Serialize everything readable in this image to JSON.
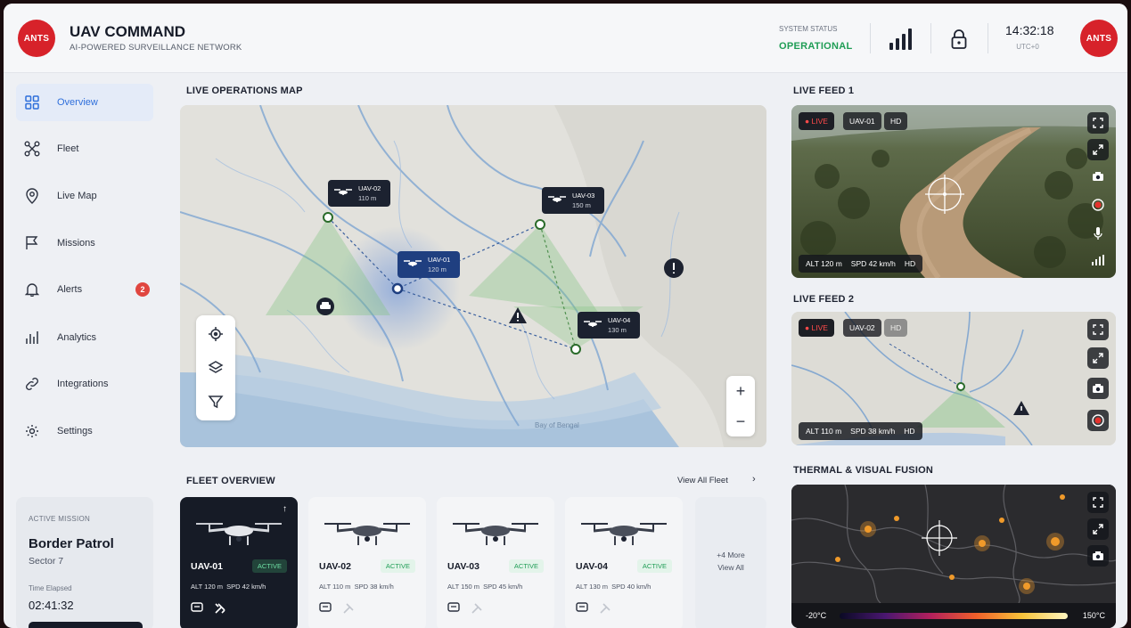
{
  "header": {
    "logo_text": "ANTS",
    "title": "UAV COMMAND",
    "subtitle": "AI-POWERED SURVEILLANCE NETWORK",
    "status_label": "SYSTEM STATUS",
    "status_value": "OPERATIONAL",
    "status_color": "#1f9d55",
    "time": "14:32:18",
    "timezone": "UTC+0",
    "icons": [
      "signal-icon",
      "lock-icon"
    ],
    "accent_color": "#d7222a"
  },
  "sidebar": {
    "items": [
      {
        "label": "Overview",
        "icon": "grid-icon",
        "active": true
      },
      {
        "label": "Fleet",
        "icon": "drone-icon"
      },
      {
        "label": "Live Map",
        "icon": "map-pin-icon"
      },
      {
        "label": "Missions",
        "icon": "flag-icon"
      },
      {
        "label": "Alerts",
        "icon": "bell-icon",
        "badge": "2"
      },
      {
        "label": "Analytics",
        "icon": "bar-chart-icon"
      },
      {
        "label": "Integrations",
        "icon": "link-icon"
      },
      {
        "label": "Settings",
        "icon": "gear-icon"
      }
    ],
    "mission": {
      "label": "ACTIVE MISSION",
      "name": "Border Patrol",
      "sector": "Sector 7",
      "elapsed_label": "Time Elapsed",
      "elapsed_value": "02:41:32"
    }
  },
  "map": {
    "title": "LIVE OPERATIONS MAP",
    "water_label": "Bay of Bengal",
    "markers": [
      {
        "id": "UAV-02",
        "alt": "110 m"
      },
      {
        "id": "UAV-03",
        "alt": "150 m"
      },
      {
        "id": "UAV-01",
        "alt": "120 m",
        "selected": true
      },
      {
        "id": "UAV-04",
        "alt": "130 m"
      }
    ],
    "zoom_in": "+",
    "zoom_out": "−"
  },
  "feeds": [
    {
      "title": "LIVE FEED 1",
      "live": "● LIVE",
      "uav": "UAV-01",
      "quality": "HD",
      "alt": "ALT 120 m",
      "speed": "SPD 42 km/h",
      "hd": "HD"
    },
    {
      "title": "LIVE FEED 2",
      "live": "● LIVE",
      "uav": "UAV-02",
      "quality": "HD",
      "alt": "ALT 110 m",
      "speed": "SPD 38 km/h",
      "hd": "HD"
    }
  ],
  "fleet": {
    "title": "FLEET OVERVIEW",
    "view_all": "View All Fleet",
    "cards": [
      {
        "id": "UAV-01",
        "status": "ACTIVE",
        "alt": "ALT 120 m",
        "speed": "SPD 42 km/h",
        "selected": true
      },
      {
        "id": "UAV-02",
        "status": "ACTIVE",
        "alt": "ALT 110 m",
        "speed": "SPD 38 km/h"
      },
      {
        "id": "UAV-03",
        "status": "ACTIVE",
        "alt": "ALT 150 m",
        "speed": "SPD 45 km/h"
      },
      {
        "id": "UAV-04",
        "status": "ACTIVE",
        "alt": "ALT 130 m",
        "speed": "SPD 40 km/h"
      }
    ],
    "more_line1": "+4 More",
    "more_line2": "View All"
  },
  "thermal": {
    "title": "THERMAL & VISUAL FUSION",
    "min": "-20°C",
    "max": "150°C"
  }
}
